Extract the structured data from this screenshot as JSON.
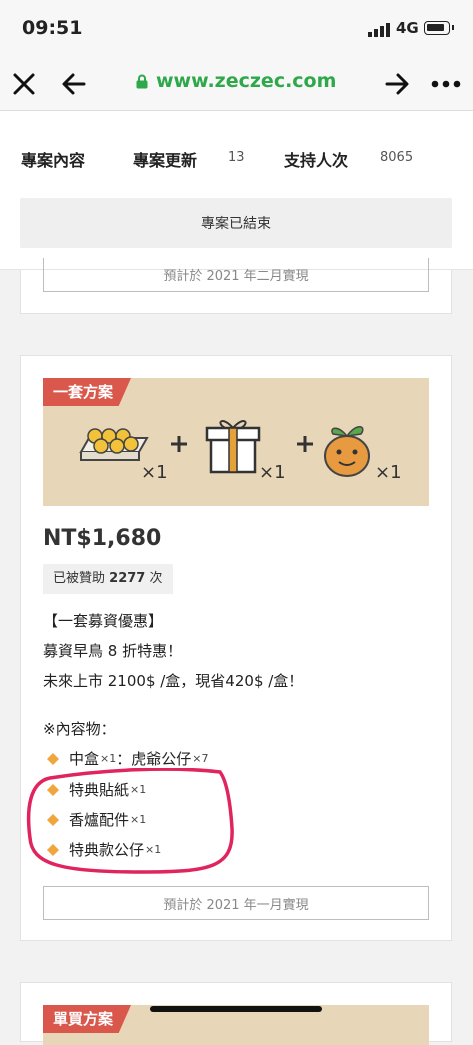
{
  "status": {
    "time": "09:51",
    "network": "4G"
  },
  "browser": {
    "url": "www.zeczec.com",
    "close_icon": "close-icon",
    "back_icon": "arrow-left-icon",
    "forward_icon": "arrow-right-icon",
    "more_icon": "more-icon"
  },
  "tabs": [
    {
      "label": "專案內容",
      "count": ""
    },
    {
      "label": "專案更新",
      "count": "13"
    },
    {
      "label": "支持人次",
      "count": "8065"
    }
  ],
  "project_status": "專案已結束",
  "prev_card": {
    "delivery": "預計於 2021 年二月實現"
  },
  "reward": {
    "label": "一套方案",
    "banner_quantities": [
      "×1",
      "×1",
      "×1"
    ],
    "price": "NT$1,680",
    "backed_prefix": "已被贊助",
    "backed_count": "2277",
    "backed_suffix": "次",
    "desc_lines": [
      "【一套募資優惠】",
      "募資早鳥 8 折特惠！",
      "未來上市 2100$ /盒，現省420$ /盒！"
    ],
    "contents_title": "※內容物：",
    "items": [
      {
        "name": "中盒",
        "qty": "×1",
        "extra": "：虎爺公仔",
        "extra_qty": "×7"
      },
      {
        "name": "特典貼紙",
        "qty": "×1",
        "extra": "",
        "extra_qty": ""
      },
      {
        "name": "香爐配件",
        "qty": "×1",
        "extra": "",
        "extra_qty": ""
      },
      {
        "name": "特典款公仔",
        "qty": "×1",
        "extra": "",
        "extra_qty": ""
      }
    ],
    "delivery": "預計於 2021 年一月實現"
  },
  "next_card": {
    "label": "單買方案"
  },
  "colors": {
    "accent_green": "#2ea84a",
    "label_red": "#d9574b",
    "annotation_red": "#e0245e",
    "diamond_orange": "#f0a63c"
  }
}
